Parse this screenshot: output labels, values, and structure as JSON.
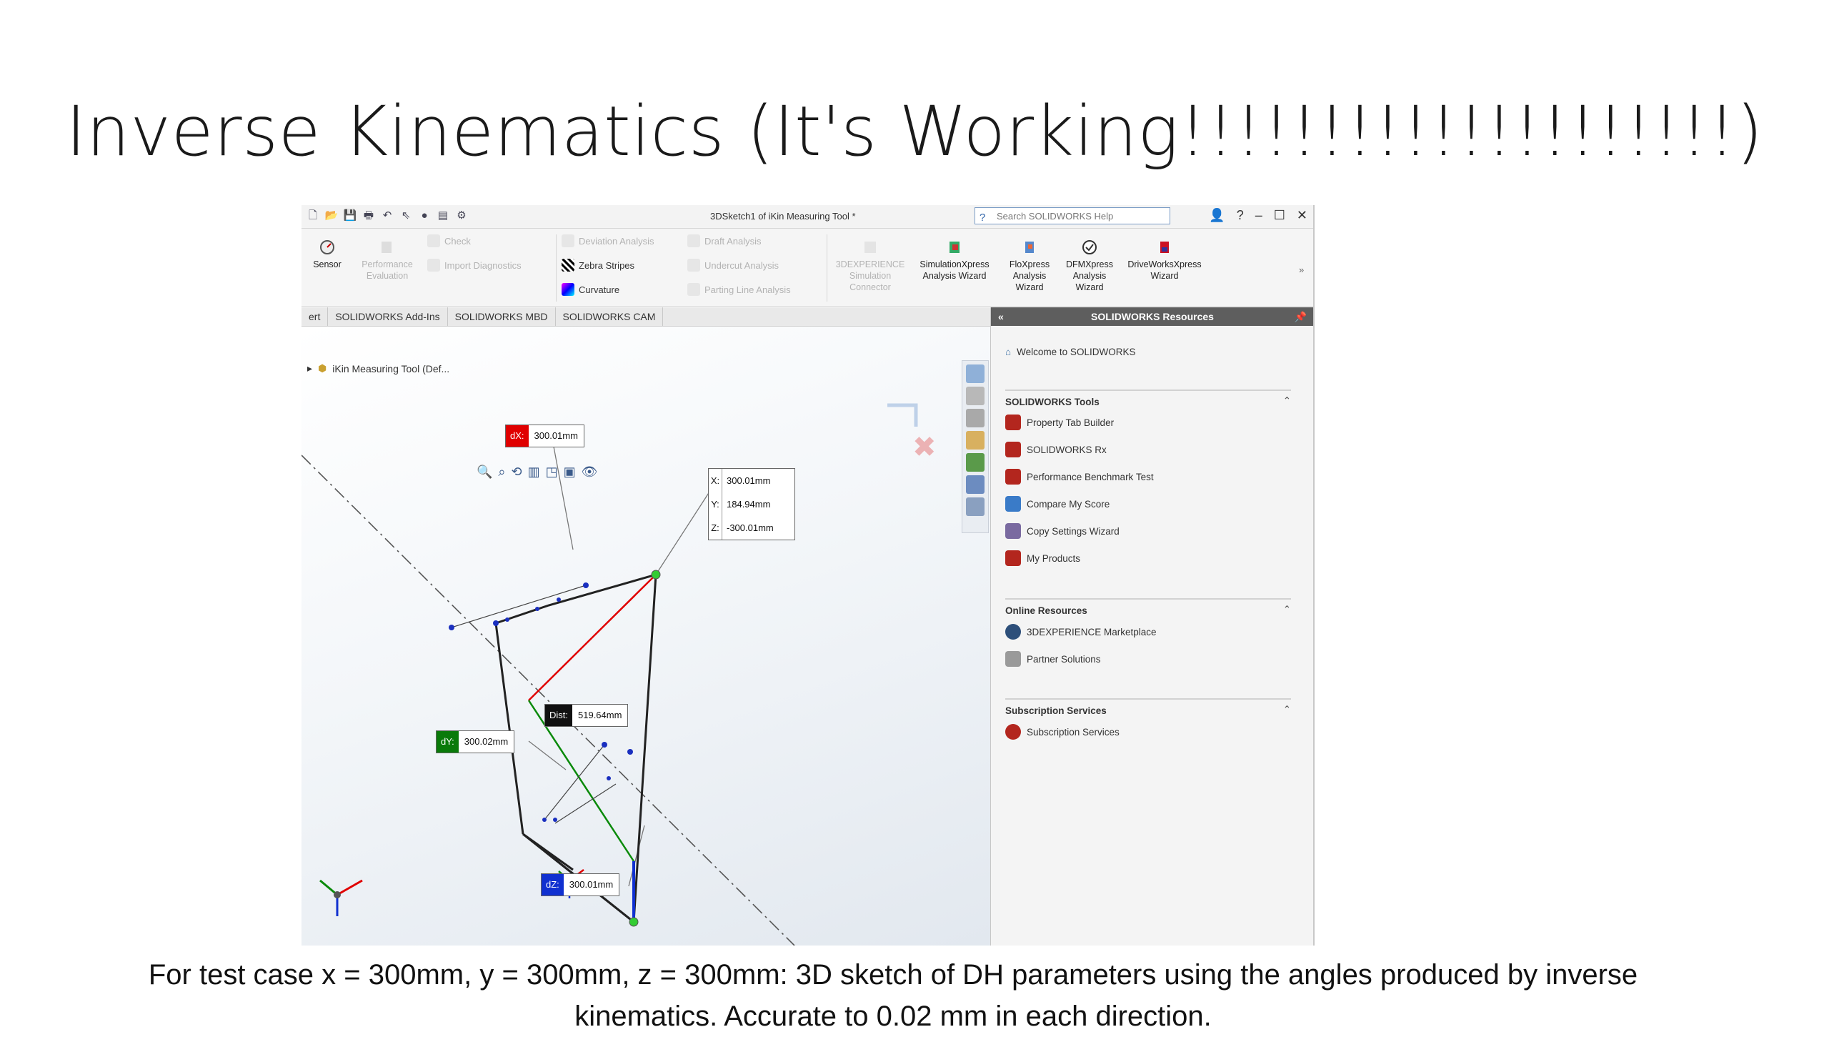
{
  "slide": {
    "title": "Inverse Kinematics (It's Working!!!!!!!!!!!!!!!!!!!!)",
    "caption_line1": "For test case x = 300mm, y = 300mm, z = 300mm:  3D sketch of DH parameters using the angles produced by inverse",
    "caption_line2": "kinematics. Accurate to 0.02 mm in each direction."
  },
  "window": {
    "title": "3DSketch1 of iKin Measuring Tool *",
    "help_search_placeholder": "Search SOLIDWORKS Help",
    "buttons": [
      "–",
      "☐",
      "✕"
    ]
  },
  "ribbon": {
    "sensor": "Sensor",
    "performance_evaluation": "Performance Evaluation",
    "check": "Check",
    "import_diagnostics": "Import Diagnostics",
    "deviation_analysis": "Deviation Analysis",
    "zebra_stripes": "Zebra Stripes",
    "curvature": "Curvature",
    "draft_analysis": "Draft Analysis",
    "undercut_analysis": "Undercut Analysis",
    "parting_line_analysis": "Parting Line Analysis",
    "experience_connector": "3DEXPERIENCE Simulation Connector",
    "simulationxpress": "SimulationXpress Analysis Wizard",
    "floxpress": "FloXpress Analysis Wizard",
    "dfmxpress": "DFMXpress Analysis Wizard",
    "driveworksxpress": "DriveWorksXpress Wizard",
    "more": "»"
  },
  "tabs": [
    "ert",
    "SOLIDWORKS Add-Ins",
    "SOLIDWORKS MBD",
    "SOLIDWORKS CAM"
  ],
  "tree": {
    "item": "iKin Measuring Tool  (Def..."
  },
  "dimensions": {
    "dx": {
      "tag": "dX:",
      "value": "300.01mm"
    },
    "dy": {
      "tag": "dY:",
      "value": "300.02mm"
    },
    "dz": {
      "tag": "dZ:",
      "value": "300.01mm"
    },
    "dist": {
      "tag": "Dist:",
      "value": "519.64mm"
    }
  },
  "coords": {
    "x": "300.01mm",
    "y": "184.94mm",
    "z": "-300.01mm"
  },
  "resources": {
    "header": "SOLIDWORKS Resources",
    "collapse": "«",
    "pin": "📌",
    "welcome": "Welcome to SOLIDWORKS",
    "tools_title": "SOLIDWORKS Tools",
    "tools": [
      "Property Tab Builder",
      "SOLIDWORKS Rx",
      "Performance Benchmark Test",
      "Compare My Score",
      "Copy Settings Wizard",
      "My Products"
    ],
    "online_title": "Online Resources",
    "online": [
      "3DEXPERIENCE Marketplace",
      "Partner Solutions"
    ],
    "subs_title": "Subscription Services",
    "subs": [
      "Subscription Services"
    ]
  },
  "colors": {
    "dx": "#e00000",
    "dy": "#0a7a0a",
    "dz": "#1030d0",
    "dist": "#111111",
    "point": "#33cc33"
  }
}
